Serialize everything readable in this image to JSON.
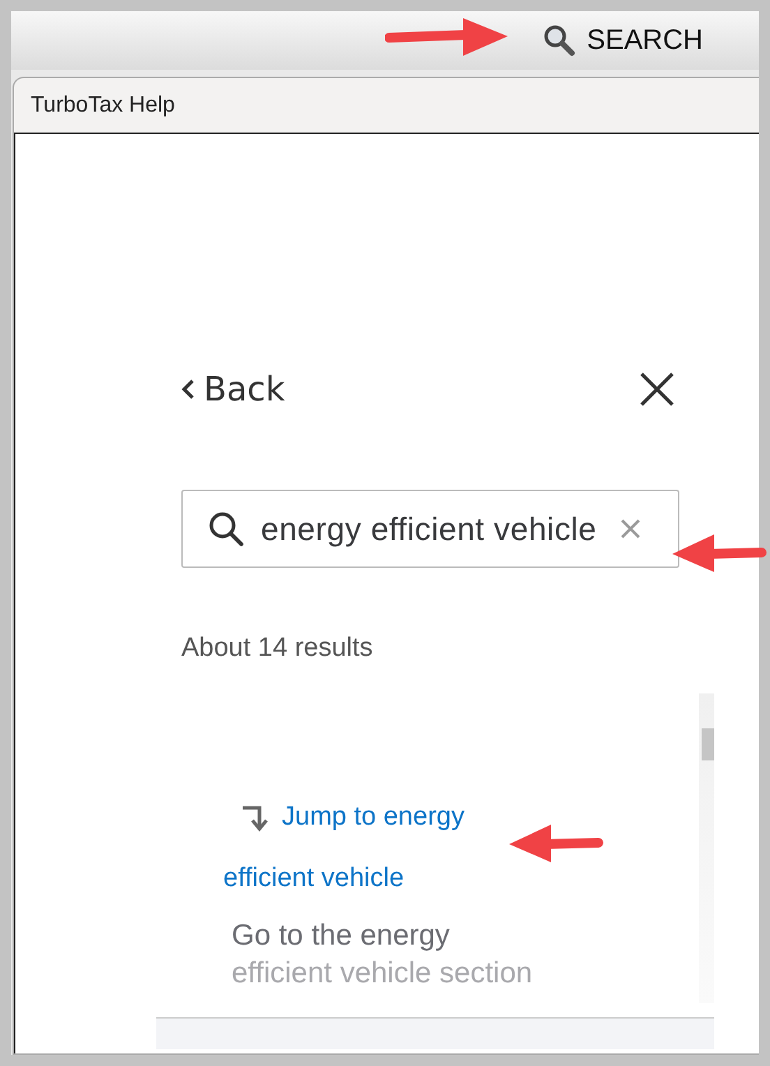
{
  "toolbar": {
    "search_label": "SEARCH"
  },
  "window": {
    "title": "TurboTax Help"
  },
  "nav": {
    "back_label": "Back"
  },
  "search": {
    "value": "energy efficient vehicle"
  },
  "results": {
    "count": "About 14 results",
    "items": [
      {
        "link_lines": [
          "Jump to energy",
          "efficient vehicle"
        ],
        "description_lines": [
          "Go to the energy",
          "efficient vehicle section"
        ]
      }
    ]
  }
}
